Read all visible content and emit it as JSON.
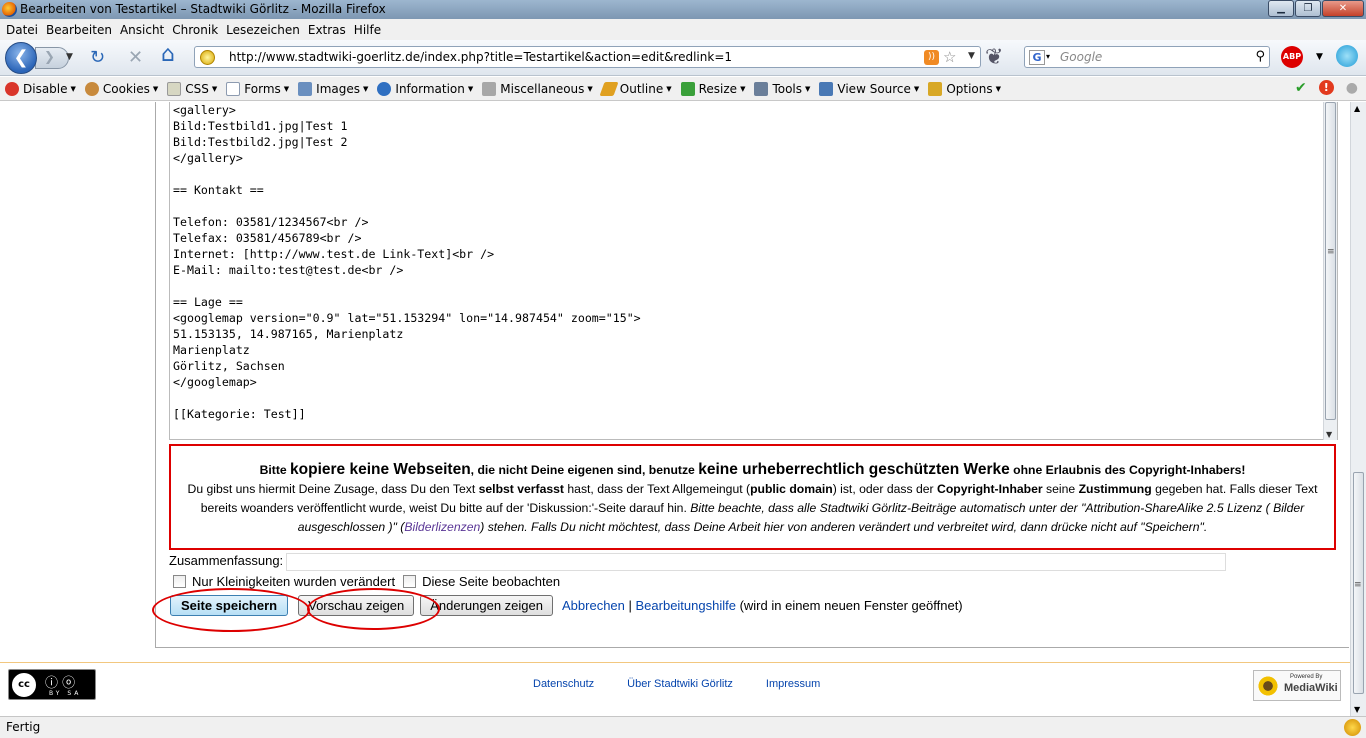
{
  "window": {
    "title": "Bearbeiten von Testartikel – Stadtwiki Görlitz - Mozilla Firefox",
    "buttons": {
      "minimize": "▁",
      "maximize": "❐",
      "close": "✕"
    }
  },
  "menu": {
    "items": [
      "Datei",
      "Bearbeiten",
      "Ansicht",
      "Chronik",
      "Lesezeichen",
      "Extras",
      "Hilfe"
    ]
  },
  "nav": {
    "back_glyph": "❮",
    "forward_glyph": "❯",
    "reload_glyph": "↻",
    "stop_glyph": "✕",
    "home_glyph": "⌂",
    "url": "http://www.stadtwiki-goerlitz.de/index.php?title=Testartikel&action=edit&redlink=1",
    "search_engine": "G",
    "search_placeholder": "Google",
    "abp_label": "ABP"
  },
  "devbar": {
    "items": [
      "Disable",
      "Cookies",
      "CSS",
      "Forms",
      "Images",
      "Information",
      "Miscellaneous",
      "Outline",
      "Resize",
      "Tools",
      "View Source",
      "Options"
    ],
    "icon_colors": [
      "#d9352a",
      "#c88a3c",
      "#d7d7c2",
      "#8d9bb0",
      "#6a8fbf",
      "#2f6fc1",
      "#a7a7a7",
      "#e0a020",
      "#3aa03a",
      "#6b7f9a",
      "#4a79b5",
      "#d8a826"
    ],
    "status_icons": [
      "✔",
      "!",
      "●"
    ]
  },
  "editor": {
    "wikitext": "<gallery>\nBild:Testbild1.jpg|Test 1\nBild:Testbild2.jpg|Test 2\n</gallery>\n\n== Kontakt ==\n\nTelefon: 03581/1234567<br />\nTelefax: 03581/456789<br />\nInternet: [http://www.test.de Link-Text]<br />\nE-Mail: mailto:test@test.de<br />\n\n== Lage ==\n<googlemap version=\"0.9\" lat=\"51.153294\" lon=\"14.987454\" zoom=\"15\">\n51.153135, 14.987165, Marienplatz\nMarienplatz\nGörlitz, Sachsen\n</googlemap>\n\n[[Kategorie: Test]]"
  },
  "copywarn": {
    "l1_a": "Bitte ",
    "l1_b": "kopiere keine Webseiten",
    "l1_c": ", die nicht Deine eigenen sind, benutze ",
    "l1_d": "keine urheberrechtlich geschützten Werke",
    "l1_e": " ohne Erlaubnis des Copyright-Inhabers!",
    "l2_a": "Du gibst uns hiermit Deine Zusage, dass Du den Text ",
    "l2_b": "selbst verfasst",
    "l2_c": " hast, dass der Text Allgemeingut (",
    "l2_d": "public domain",
    "l2_e": ") ist, oder dass der ",
    "l2_f": "Copyright-Inhaber",
    "l2_g": " seine ",
    "l2_h": "Zustimmung",
    "l2_i": " gegeben hat. Falls dieser Text bereits woanders veröffentlicht wurde, weist Du bitte auf der 'Diskussion:'-Seite darauf hin. ",
    "l2_j": "Bitte beachte, dass alle Stadtwiki Görlitz-Beiträge automatisch unter der \"Attribution-ShareAlike 2.5 Lizenz ( Bilder ausgeschlossen )\" (",
    "l2_link": "Bilderlizenzen",
    "l2_k": ") stehen. Falls Du nicht möchtest, dass Deine Arbeit hier von anderen verändert und verbreitet wird, dann drücke nicht auf \"Speichern\"."
  },
  "form": {
    "summary_label": "Zusammenfassung:",
    "summary_value": "",
    "minor_label": "Nur Kleinigkeiten wurden verändert",
    "minor_checked": false,
    "watch_label": "Diese Seite beobachten",
    "watch_checked": false,
    "save_label": "Seite speichern",
    "preview_label": "Vorschau zeigen",
    "diff_label": "Änderungen zeigen",
    "cancel_link": "Abbrechen",
    "separator": " | ",
    "help_link": "Bearbeitungshilfe",
    "help_note": " (wird in einem neuen Fenster geöffnet)"
  },
  "footer": {
    "links": [
      "Datenschutz",
      "Über Stadtwiki Görlitz",
      "Impressum"
    ],
    "cc_badge": {
      "cc": "cc",
      "by": "ⓘ ⓞ",
      "label": "BY SA"
    },
    "mediawiki_badge": {
      "powered": "Powered By",
      "name": "MediaWiki"
    }
  },
  "status": {
    "text": "Fertig"
  },
  "colors": {
    "annotation_red": "#dd0000",
    "link": "#0645ad",
    "visited_link": "#5a3696"
  }
}
